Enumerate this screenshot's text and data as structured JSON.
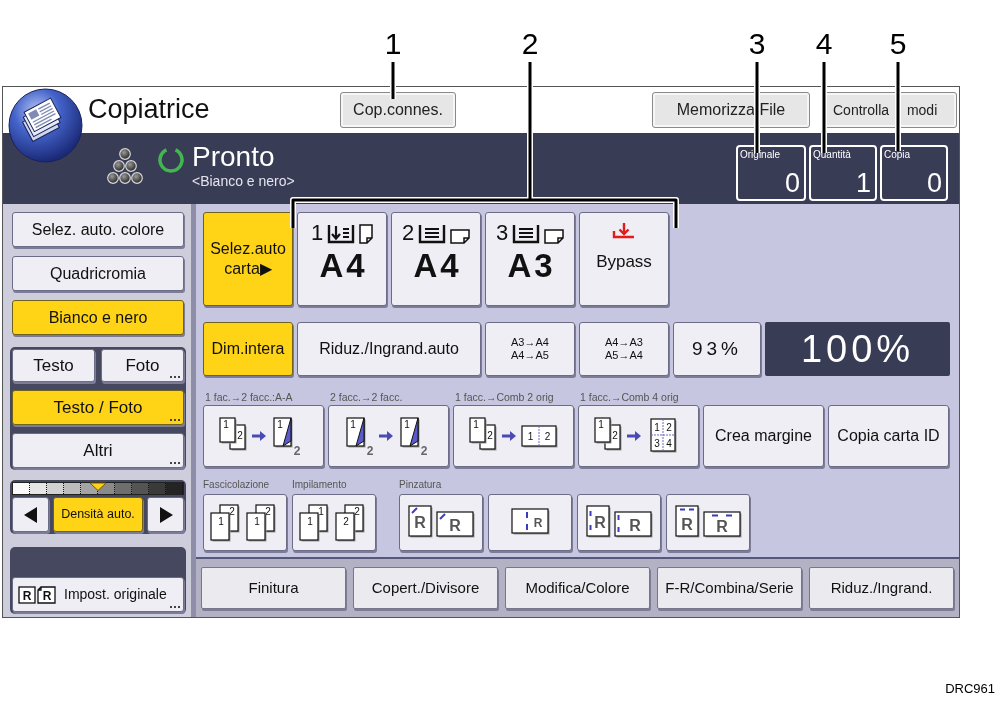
{
  "callouts": [
    {
      "label": "1",
      "kind": "line"
    },
    {
      "label": "2",
      "kind": "bracket"
    },
    {
      "label": "3",
      "kind": "line"
    },
    {
      "label": "4",
      "kind": "line"
    },
    {
      "label": "5",
      "kind": "line"
    }
  ],
  "header": {
    "title": "Copiatrice",
    "buttons": [
      {
        "label": "Cop.connes."
      },
      {
        "label": "Memorizza File"
      },
      {
        "label": "Controlla modi"
      }
    ]
  },
  "status": {
    "state": "Pronto",
    "mode": "<Bianco e nero>"
  },
  "counters": [
    {
      "label": "Originale",
      "value": "0"
    },
    {
      "label": "Quantità",
      "value": "1"
    },
    {
      "label": "Copia",
      "value": "0"
    }
  ],
  "color_modes": [
    {
      "label": "Selez. auto. colore",
      "selected": false
    },
    {
      "label": "Quadricromia",
      "selected": false
    },
    {
      "label": "Bianco e nero",
      "selected": true
    }
  ],
  "original_types": [
    {
      "kind": "half",
      "label": "Testo",
      "selected": false,
      "more": false
    },
    {
      "kind": "half",
      "label": "Foto",
      "selected": false,
      "more": true
    },
    {
      "kind": "full",
      "label": "Testo / Foto",
      "selected": true,
      "more": true
    },
    {
      "kind": "full",
      "label": "Altri",
      "selected": false,
      "more": true
    }
  ],
  "density": {
    "level": 0.5,
    "label": "Densità auto.",
    "selected": true
  },
  "original_settings": {
    "label": "Impost. originale",
    "marks": [
      "R",
      "R"
    ],
    "more": true
  },
  "paper": [
    {
      "kind": "auto",
      "label": "Selez.auto carta▶",
      "selected": true
    },
    {
      "kind": "tray",
      "number": "1",
      "feed_arrow": true,
      "landscape": false,
      "size": "A4",
      "selected": false
    },
    {
      "kind": "tray",
      "number": "2",
      "feed_arrow": false,
      "landscape": true,
      "size": "A4",
      "selected": false
    },
    {
      "kind": "tray",
      "number": "3",
      "feed_arrow": false,
      "landscape": true,
      "size": "A3",
      "selected": false
    },
    {
      "kind": "bypass",
      "label": "Bypass",
      "selected": false
    }
  ],
  "ratios": [
    {
      "kind": "text",
      "label": "Dim.intera",
      "selected": true
    },
    {
      "kind": "text",
      "label": "Riduz./Ingrand.auto",
      "selected": false
    },
    {
      "kind": "pair",
      "lines": [
        "A3→A4",
        "A4→A5"
      ],
      "selected": false
    },
    {
      "kind": "pair",
      "lines": [
        "A4→A3",
        "A5→A4"
      ],
      "selected": false
    },
    {
      "kind": "percent",
      "label": "93%",
      "selected": false
    }
  ],
  "ratio_display": "100%",
  "layout_options": [
    {
      "kind": "one-to-two",
      "caption": "1 fac.→2 facc.:A-A",
      "marks": [
        "1",
        "2",
        "1",
        "2"
      ]
    },
    {
      "kind": "two-to-two",
      "caption": "2 facc.→2 facc.",
      "marks": [
        "1",
        "2",
        "1",
        "2"
      ]
    },
    {
      "kind": "combine-2",
      "caption": "1 facc.→Comb 2 orig",
      "marks": [
        "1",
        "2",
        "1",
        "2"
      ]
    },
    {
      "kind": "combine-4",
      "caption": "1 facc.→Comb 4 orig",
      "marks": [
        "1",
        "2",
        "1",
        "2",
        "3",
        "4"
      ]
    },
    {
      "kind": "text",
      "label": "Crea margine"
    },
    {
      "kind": "text",
      "label": "Copia carta ID"
    }
  ],
  "finishing": [
    {
      "caption": "Fascicolazione",
      "buttons": [
        {
          "kind": "sort",
          "marks": [
            "1",
            "2",
            "1",
            "2"
          ]
        }
      ]
    },
    {
      "caption": "Impilamento",
      "buttons": [
        {
          "kind": "stack",
          "marks": [
            "1",
            "1",
            "2",
            "2"
          ]
        }
      ]
    },
    {
      "caption": "Pinzatura",
      "buttons": [
        {
          "kind": "staple-corner",
          "marks": [
            "R",
            "R"
          ]
        },
        {
          "kind": "staple-middle",
          "marks": [
            "R"
          ]
        },
        {
          "kind": "staple-left",
          "marks": [
            "R",
            "R"
          ]
        },
        {
          "kind": "staple-top",
          "marks": [
            "R",
            "R"
          ]
        }
      ]
    }
  ],
  "tabs": [
    "Finitura",
    "Copert./Divisore",
    "Modifica/Colore",
    "F-R/Combina/Serie",
    "Riduz./Ingrand."
  ],
  "figure_code": "DRC961"
}
